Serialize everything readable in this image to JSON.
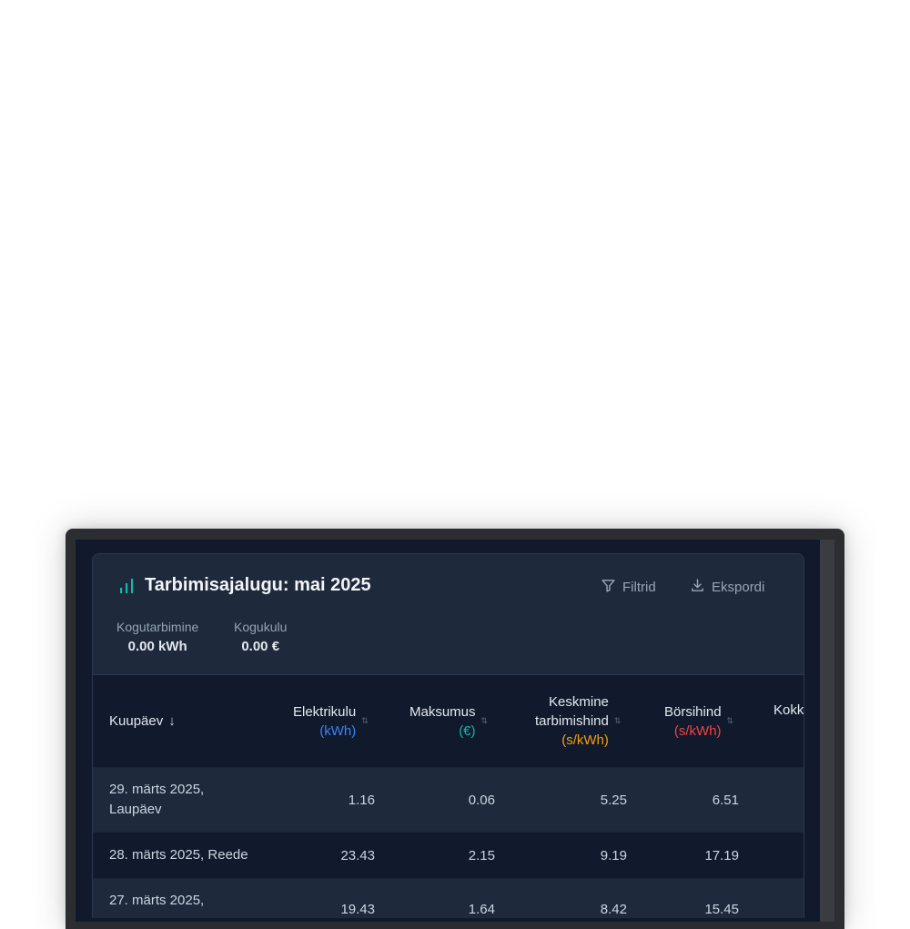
{
  "header": {
    "title": "Tarbimisajalugu: mai 2025",
    "icon": "bar-chart-icon",
    "filters_label": "Filtrid",
    "export_label": "Ekspordi"
  },
  "summary": {
    "total_consumption_label": "Kogutarbimine",
    "total_consumption_value": "0.00 kWh",
    "total_cost_label": "Kogukulu",
    "total_cost_value": "0.00 €"
  },
  "table": {
    "columns": [
      {
        "label": "Kuupäev",
        "unit": "",
        "sorted": "desc"
      },
      {
        "label": "Elektrikulu",
        "unit": "(kWh)",
        "unit_color": "#3b82f6"
      },
      {
        "label": "Maksumus",
        "unit": "(€)",
        "unit_color": "#14b8a6"
      },
      {
        "label": "Keskmine tarbimishind",
        "label_line1": "Keskmine",
        "label_line2": "tarbimishind",
        "unit": "(s/kWh)",
        "unit_color": "#f59e0b"
      },
      {
        "label": "Börsihind",
        "unit": "(s/kWh)",
        "unit_color": "#ef4444"
      },
      {
        "label": "Kokk",
        "unit": ""
      }
    ],
    "rows": [
      {
        "date_line1": "29. märts 2025,",
        "date_line2": "Laupäev",
        "consumption": "1.16",
        "cost": "0.06",
        "avg_price": "5.25",
        "exchange_price": "6.51"
      },
      {
        "date_line1": "28. märts 2025, Reede",
        "date_line2": "",
        "consumption": "23.43",
        "cost": "2.15",
        "avg_price": "9.19",
        "exchange_price": "17.19"
      },
      {
        "date_line1": "27. märts 2025,",
        "date_line2": "",
        "consumption": "19.43",
        "cost": "1.64",
        "avg_price": "8.42",
        "exchange_price": "15.45"
      }
    ]
  },
  "colors": {
    "accent": "#14b8a6",
    "kwh": "#3b82f6",
    "eur": "#14b8a6",
    "avg_price": "#f59e0b",
    "exchange_price": "#ef4444"
  }
}
